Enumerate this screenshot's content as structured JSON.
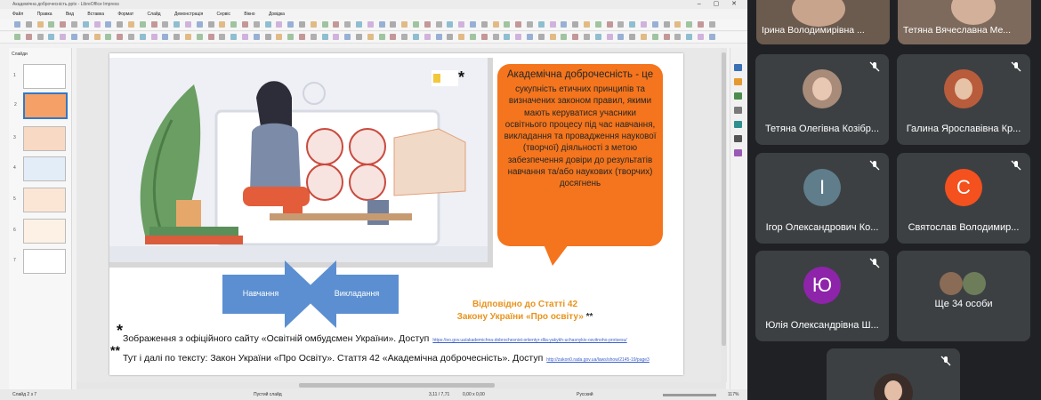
{
  "window": {
    "title": "Академічна доброчесність.pptx - LibreOffice Impress"
  },
  "menu": [
    "Файл",
    "Правка",
    "Вид",
    "Вставка",
    "Формат",
    "Слайд",
    "Демонстрація",
    "Сервіс",
    "Вікно",
    "Довідка"
  ],
  "slides_panel": {
    "title": "Слайди",
    "count": 7,
    "selected": 2
  },
  "slide": {
    "bubble_title": "Академічна доброчесність - це",
    "bubble_body": "сукупність етичних принципів та визначених законом правил, якими мають керуватися учасники освітнього процесу під час навчання, викладання та провадження наукової (творчої) діяльності з метою забезпечення довіри до результатів навчання та/або наукових (творчих) досягнень",
    "arrow_left": "Навчання",
    "arrow_right": "Викладання",
    "reference_line1": "Відповідно до Статті 42",
    "reference_line2": "Закону України «Про освіту»",
    "reference_stars": "**",
    "footnote1_star": "*",
    "footnote1_text": "Зображення з офіційного сайту «Освітній омбудсмен України». Доступ",
    "footnote1_link": "https://eo.gov.ua/akademichna-dobrochesnist-oriientyr-dlia-yakykh-uchasnykiv-osvitnoho-protsesu/",
    "footnote2_star": "**",
    "footnote2_text": "Тут і далі по тексту: Закон України «Про Освіту». Стаття 42 «Академічна доброчесність». Доступ",
    "footnote2_link": "http://zakon0.rada.gov.ua/laws/show/2145-19/page3",
    "image_star": "*"
  },
  "statusbar": {
    "slide": "Слайд 2 з 7",
    "layout": "Пустий слайд",
    "coords": "3,11 / 7,71",
    "size": "0,00 x 0,00",
    "lang": "Русский",
    "zoom": "117%"
  },
  "participants": [
    {
      "name": "Ірина Володимирівна ...",
      "type": "video"
    },
    {
      "name": "Тетяна Вячеславна Ме...",
      "type": "video"
    },
    {
      "name": "Тетяна Олегівна Козібр...",
      "type": "photo"
    },
    {
      "name": "Галина Ярославівна Кр...",
      "type": "photo"
    },
    {
      "name": "Ігор Олександрович Ко...",
      "type": "initial",
      "initial": "І",
      "color": "#607d8b"
    },
    {
      "name": "Святослав Володимир...",
      "type": "initial",
      "initial": "С",
      "color": "#f4511e"
    },
    {
      "name": "Юлія Олександрівна Ш...",
      "type": "initial",
      "initial": "Ю",
      "color": "#8e24aa"
    },
    {
      "name": "Ще 34 особи",
      "type": "more"
    }
  ]
}
